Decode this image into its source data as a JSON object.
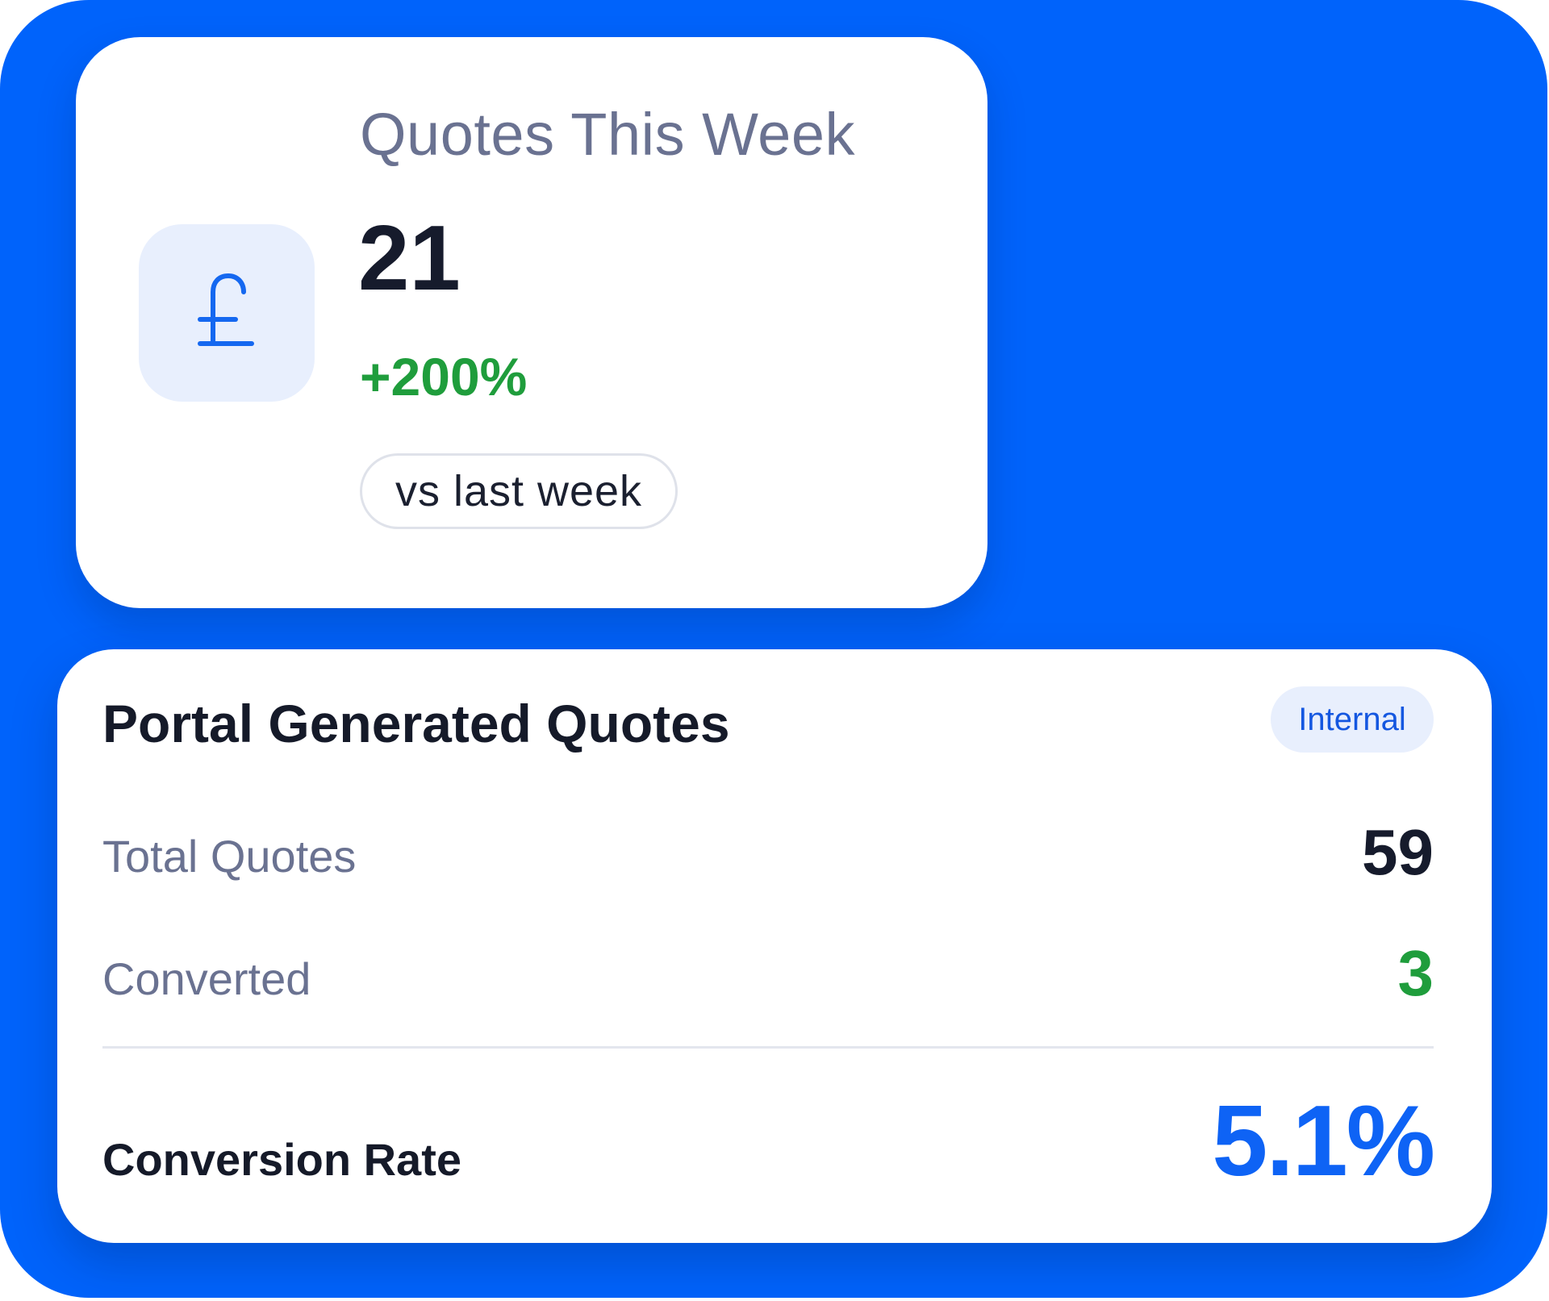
{
  "colors": {
    "background": "#0063fb",
    "accent_blue": "#0e63f5",
    "positive_green": "#1f9d3c",
    "muted_text": "#6a7291",
    "dark_text": "#161b2c",
    "icon_tile": "#e8effd"
  },
  "weekly_card": {
    "icon": "pound-sterling-icon",
    "title": "Quotes This Week",
    "count": "21",
    "change": "+200%",
    "comparison_label": "vs last week"
  },
  "portal_card": {
    "title": "Portal Generated Quotes",
    "badge": "Internal",
    "total_label": "Total Quotes",
    "total_value": "59",
    "converted_label": "Converted",
    "converted_value": "3",
    "rate_label": "Conversion Rate",
    "rate_value": "5.1%"
  }
}
